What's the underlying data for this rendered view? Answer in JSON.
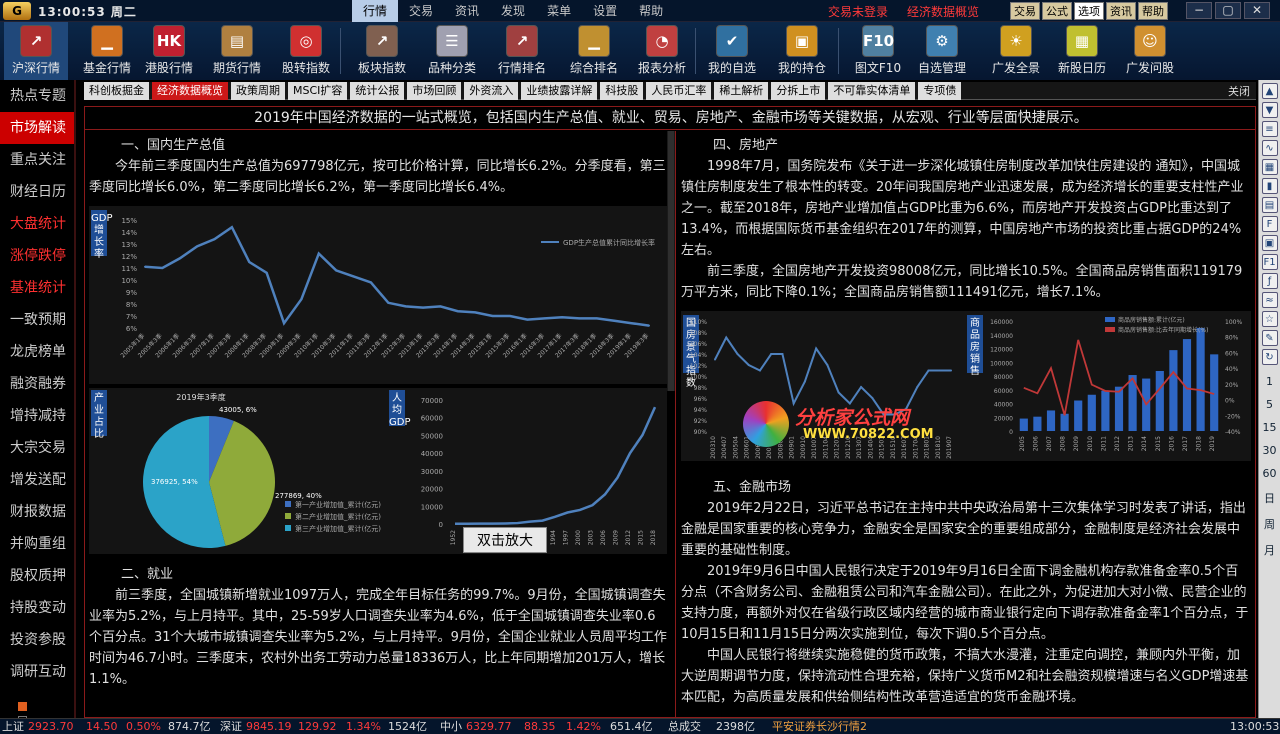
{
  "titlebar": {
    "logo": "G",
    "clock": "13:00:53  周二",
    "menu": [
      "行情",
      "交易",
      "资讯",
      "发现",
      "菜单",
      "设置",
      "帮助"
    ],
    "links": [
      "交易未登录",
      "经济数据概览"
    ],
    "minibtns": [
      "交易",
      "公式",
      "选项",
      "资讯",
      "帮助"
    ],
    "winbtns": [
      "−",
      "▢",
      "✕"
    ]
  },
  "toolbar": [
    {
      "label": "沪深行情",
      "icon": "chart-line-icon",
      "glyph": "↗",
      "color": "#b03030",
      "sel": true
    },
    {
      "label": "基金行情",
      "icon": "bar-chart-icon",
      "glyph": "▁",
      "color": "#d07020"
    },
    {
      "label": "港股行情",
      "icon": "hk-chart-icon",
      "glyph": "HK",
      "color": "#c02030"
    },
    {
      "label": "期货行情",
      "icon": "futures-icon",
      "glyph": "▤",
      "color": "#b08040"
    },
    {
      "label": "股转指数",
      "icon": "globe-icon",
      "glyph": "◎",
      "color": "#d03030"
    },
    {
      "label": "板块指数",
      "icon": "sector-chart-icon",
      "glyph": "↗",
      "color": "#806050"
    },
    {
      "label": "品种分类",
      "icon": "category-icon",
      "glyph": "☰",
      "color": "#a0a0b0"
    },
    {
      "label": "行情排名",
      "icon": "rank-line-icon",
      "glyph": "↗",
      "color": "#a04040"
    },
    {
      "label": "综合排名",
      "icon": "rank-bar-icon",
      "glyph": "▁",
      "color": "#c09030"
    },
    {
      "label": "报表分析",
      "icon": "report-icon",
      "glyph": "◔",
      "color": "#c04040"
    },
    {
      "label": "我的自选",
      "icon": "watchlist-icon",
      "glyph": "✔",
      "color": "#3070a0"
    },
    {
      "label": "我的持仓",
      "icon": "position-icon",
      "glyph": "▣",
      "color": "#d09020"
    },
    {
      "label": "图文F10",
      "icon": "f10-icon",
      "glyph": "F10",
      "color": "#5080a0"
    },
    {
      "label": "自选管理",
      "icon": "manage-icon",
      "glyph": "⚙",
      "color": "#4080b0"
    },
    {
      "label": "广发全景",
      "icon": "panorama-icon",
      "glyph": "☀",
      "color": "#d0a020"
    },
    {
      "label": "新股日历",
      "icon": "calendar-icon",
      "glyph": "▦",
      "color": "#c0c030"
    },
    {
      "label": "广发问股",
      "icon": "advisor-icon",
      "glyph": "☺",
      "color": "#d09030"
    }
  ],
  "leftnav": [
    {
      "label": "热点专题",
      "red": false
    },
    {
      "label": "市场解读",
      "sel": true
    },
    {
      "label": "重点关注"
    },
    {
      "label": "财经日历"
    },
    {
      "label": "大盘统计",
      "red": true
    },
    {
      "label": "涨停跌停",
      "red": true
    },
    {
      "label": "基准统计",
      "red": true
    },
    {
      "label": "一致预期"
    },
    {
      "label": "龙虎榜单"
    },
    {
      "label": "融资融券"
    },
    {
      "label": "增持减持"
    },
    {
      "label": "大宗交易"
    },
    {
      "label": "增发送配"
    },
    {
      "label": "财报数据"
    },
    {
      "label": "并购重组"
    },
    {
      "label": "股权质押"
    },
    {
      "label": "持股变动"
    },
    {
      "label": "投资参股"
    },
    {
      "label": "调研互动"
    }
  ],
  "tabs": [
    "科创板掘金",
    "经济数据概览",
    "政策周期",
    "MSCI扩容",
    "统计公报",
    "市场回顾",
    "外资流入",
    "业绩披露详解",
    "科技股",
    "人民币汇率",
    "稀土解析",
    "分拆上市",
    "不可靠实体清单",
    "专项债"
  ],
  "active_tab": 1,
  "close_label": "关闭",
  "headline": "2019年中国经济数据的一站式概览，包括国内生产总值、就业、贸易、房地产、金融市场等关键数据，从宏观、行业等层面快捷展示。",
  "left": {
    "s1_title": "一、国内生产总值",
    "s1_p1": "今年前三季度国内生产总值为697798亿元，按可比价格计算，同比增长6.2%。分季度看，第三季度同比增长6.0%，第二季度同比增长6.2%，第一季度同比增长6.4%。",
    "gdp_tag": "GDP增长率",
    "ind_tag": "产业占比",
    "gdp2_tag": "人均GDP",
    "zoom_label": "双击放大",
    "s2_title": "二、就业",
    "s2_p1": "前三季度，全国城镇新增就业1097万人，完成全年目标任务的99.7%。9月份，全国城镇调查失业率为5.2%，与上月持平。其中，25-59岁人口调查失业率为4.6%，低于全国城镇调查失业率0.6个百分点。31个大城市城镇调查失业率为5.2%，与上月持平。9月份，全国企业就业人员周平均工作时间为46.7小时。三季度末，农村外出务工劳动力总量18336万人，比上年同期增加201万人，增长1.1%。"
  },
  "right": {
    "s4_title": "四、房地产",
    "s4_p1": "1998年7月，国务院发布《关于进一步深化城镇住房制度改革加快住房建设的 通知》，中国城镇住房制度发生了根本性的转变。20年间我国房地产业迅速发展，成为经济增长的重要支柱性产业之一。截至2018年，房地产业增加值占GDP比重为6.6%，而房地产开发投资占GDP比重达到了13.4%，而根据国际货币基金组织在2017年的测算，中国房地产市场的投资比重占据GDP的24%左右。",
    "s4_p2": "前三季度，全国房地产开发投资98008亿元，同比增长10.5%。全国商品房销售面积119179万平方米，同比下降0.1%；全国商品房销售额111491亿元，增长7.1%。",
    "climate_tag": "国房景气指数",
    "sales_tag": "商品房销售",
    "watermark1": "分析家公式网",
    "watermark2": "WWW.70822.COM",
    "s5_title": "五、金融市场",
    "s5_p1": "2019年2月22日，习近平总书记在主持中共中央政治局第十三次集体学习时发表了讲话，指出金融是国家重要的核心竞争力，金融安全是国家安全的重要组成部分，金融制度是经济社会发展中重要的基础性制度。",
    "s5_p2": "2019年9月6日中国人民银行决定于2019年9月16日全面下调金融机构存款准备金率0.5个百分点（不含财务公司、金融租赁公司和汽车金融公司）。在此之外，为促进加大对小微、民营企业的支持力度，再额外对仅在省级行政区域内经营的城市商业银行定向下调存款准备金率1个百分点，于10月15日和11月15日分两次实施到位，每次下调0.5个百分点。",
    "s5_p3": "中国人民银行将继续实施稳健的货币政策，不搞大水漫灌，注重定向调控，兼顾内外平衡，加大逆周期调节力度，保持流动性合理充裕，保持广义货币M2和社会融资规模增速与名义GDP增速基本匹配，为高质量发展和供给侧结构性改革营造适宜的货币金融环境。"
  },
  "rightbar": {
    "icons": [
      "up-arrow-icon",
      "down-arrow-icon",
      "list-icon",
      "chart-icon",
      "grid-icon",
      "kline-icon",
      "table-icon",
      "f10-icon",
      "doc-icon",
      "f1-icon",
      "fx-icon",
      "wave-icon",
      "star-icon",
      "pen-icon",
      "refresh-icon"
    ],
    "numbers": [
      "1",
      "5",
      "15",
      "30",
      "60",
      "日",
      "周",
      "月"
    ]
  },
  "statusbar": {
    "items": [
      {
        "t": "上证",
        "c": "swhite",
        "x": 2
      },
      {
        "t": "2923.70",
        "c": "sred",
        "x": 28
      },
      {
        "t": "14.50",
        "c": "sred",
        "x": 86
      },
      {
        "t": "0.50%",
        "c": "sred",
        "x": 126
      },
      {
        "t": "874.7亿",
        "c": "swhite",
        "x": 168
      },
      {
        "t": "深证",
        "c": "swhite",
        "x": 220
      },
      {
        "t": "9845.19",
        "c": "sred",
        "x": 246
      },
      {
        "t": "129.92",
        "c": "sred",
        "x": 298
      },
      {
        "t": "1.34%",
        "c": "sred",
        "x": 346
      },
      {
        "t": "1524亿",
        "c": "swhite",
        "x": 388
      },
      {
        "t": "中小",
        "c": "swhite",
        "x": 440
      },
      {
        "t": "6329.77",
        "c": "sred",
        "x": 466
      },
      {
        "t": "88.35",
        "c": "sred",
        "x": 524
      },
      {
        "t": "1.42%",
        "c": "sred",
        "x": 566
      },
      {
        "t": "651.4亿",
        "c": "swhite",
        "x": 610
      },
      {
        "t": "总成交",
        "c": "swhite",
        "x": 668
      },
      {
        "t": "2398亿",
        "c": "swhite",
        "x": 716
      },
      {
        "t": "平安证券长沙行情2",
        "c": "sorange",
        "x": 772
      },
      {
        "t": "13:00:53",
        "c": "swhite",
        "x": 1230
      }
    ]
  },
  "chart_data": [
    {
      "type": "line",
      "title": "",
      "series": [
        {
          "name": "GDP生产总值累计同比增长率",
          "color": "#4f81bd"
        }
      ],
      "x": [
        "2005年1季",
        "2005年3季",
        "2006年1季",
        "2006年3季",
        "2007年1季",
        "2007年3季",
        "2008年1季",
        "2008年3季",
        "2009年1季",
        "2009年3季",
        "2010年1季",
        "2010年3季",
        "2011年1季",
        "2011年3季",
        "2012年1季",
        "2012年3季",
        "2013年1季",
        "2013年3季",
        "2014年1季",
        "2014年3季",
        "2015年1季",
        "2015年3季",
        "2016年1季",
        "2016年3季",
        "2017年1季",
        "2017年3季",
        "2018年1季",
        "2018年3季",
        "2019年1季",
        "2019年3季"
      ],
      "values": [
        11.1,
        11.0,
        11.8,
        12.8,
        13.4,
        14.4,
        11.5,
        10.6,
        6.4,
        8.4,
        12.2,
        10.8,
        10.3,
        9.8,
        8.1,
        7.8,
        7.7,
        7.8,
        7.4,
        7.3,
        7.0,
        7.0,
        6.7,
        6.8,
        6.9,
        6.8,
        6.8,
        6.6,
        6.4,
        6.2
      ],
      "ylim": [
        6,
        15
      ],
      "yticks": [
        "15%",
        "14%",
        "13%",
        "12%",
        "11%",
        "10%",
        "9%",
        "8%",
        "7%",
        "6%"
      ]
    },
    {
      "type": "pie",
      "title": "2019年3季度",
      "series": [
        {
          "name": "第一产业增加值_累计(亿元)",
          "value": 43005,
          "pct": "6%",
          "color": "#3d6fc1"
        },
        {
          "name": "第二产业增加值_累计(亿元)",
          "value": 277869,
          "pct": "40%",
          "color": "#8faa3a"
        },
        {
          "name": "第三产业增加值_累计(亿元)",
          "value": 376925,
          "pct": "54%",
          "color": "#2ba3c8"
        }
      ],
      "labels": [
        "43005, 6%",
        "277869, 40%",
        "376925, 54%"
      ]
    },
    {
      "type": "line",
      "title": "",
      "x": [
        "1952",
        "1958",
        "1964",
        "1970",
        "1976",
        "1982",
        "1988",
        "1991",
        "1994",
        "1997",
        "2000",
        "2003",
        "2006",
        "2009",
        "2012",
        "2015",
        "2018"
      ],
      "values": [
        119,
        168,
        208,
        228,
        316,
        528,
        1366,
        1912,
        4081,
        6481,
        7942,
        10666,
        16738,
        26180,
        40007,
        50237,
        66006
      ],
      "ylim": [
        0,
        70000
      ],
      "yticks": [
        "70000",
        "60000",
        "50000",
        "40000",
        "30000",
        "20000",
        "10000",
        "0"
      ]
    },
    {
      "type": "line",
      "title": "",
      "x": [
        "200310",
        "200407",
        "200504",
        "200601",
        "200610",
        "200707",
        "200804",
        "200901",
        "200910",
        "201007",
        "201104",
        "201201",
        "201210",
        "201307",
        "201404",
        "201501",
        "201510",
        "201607",
        "201704",
        "201801",
        "201810",
        "201907"
      ],
      "values": [
        103,
        107,
        104,
        102,
        101,
        104,
        104,
        95,
        99,
        105,
        102,
        97,
        95,
        98,
        96,
        93,
        93,
        94,
        98,
        101,
        101,
        101
      ],
      "ylim": [
        90,
        110
      ],
      "yticks": [
        "110%",
        "108%",
        "106%",
        "104%",
        "102%",
        "100%",
        "98%",
        "96%",
        "94%",
        "92%",
        "90%"
      ]
    },
    {
      "type": "bar",
      "title": "",
      "series": [
        {
          "name": "商品房销售额:累计(亿元)",
          "color": "#2e66c4"
        },
        {
          "name": "商品房销售额:比去年同期增长(%)",
          "color": "#c03838"
        }
      ],
      "categories": [
        "2005",
        "2006",
        "2007",
        "2008",
        "2009",
        "2010",
        "2011",
        "2012",
        "2013",
        "2014",
        "2015",
        "2016",
        "2017",
        "2018",
        "2019"
      ],
      "bars": [
        18080,
        20826,
        29889,
        25068,
        44355,
        52721,
        58589,
        64456,
        81428,
        76292,
        87281,
        117627,
        133701,
        149973,
        111491
      ],
      "line": [
        15,
        8,
        40,
        -20,
        76,
        19,
        11,
        10,
        27,
        -6,
        14,
        35,
        14,
        12,
        7
      ],
      "ylim": [
        0,
        160000
      ],
      "y2lim": [
        -40,
        100
      ],
      "yticks": [
        "160000",
        "140000",
        "120000",
        "100000",
        "80000",
        "60000",
        "40000",
        "20000",
        "0"
      ],
      "y2ticks": [
        "100%",
        "80%",
        "60%",
        "40%",
        "20%",
        "0%",
        "-20%",
        "-40%"
      ]
    }
  ]
}
